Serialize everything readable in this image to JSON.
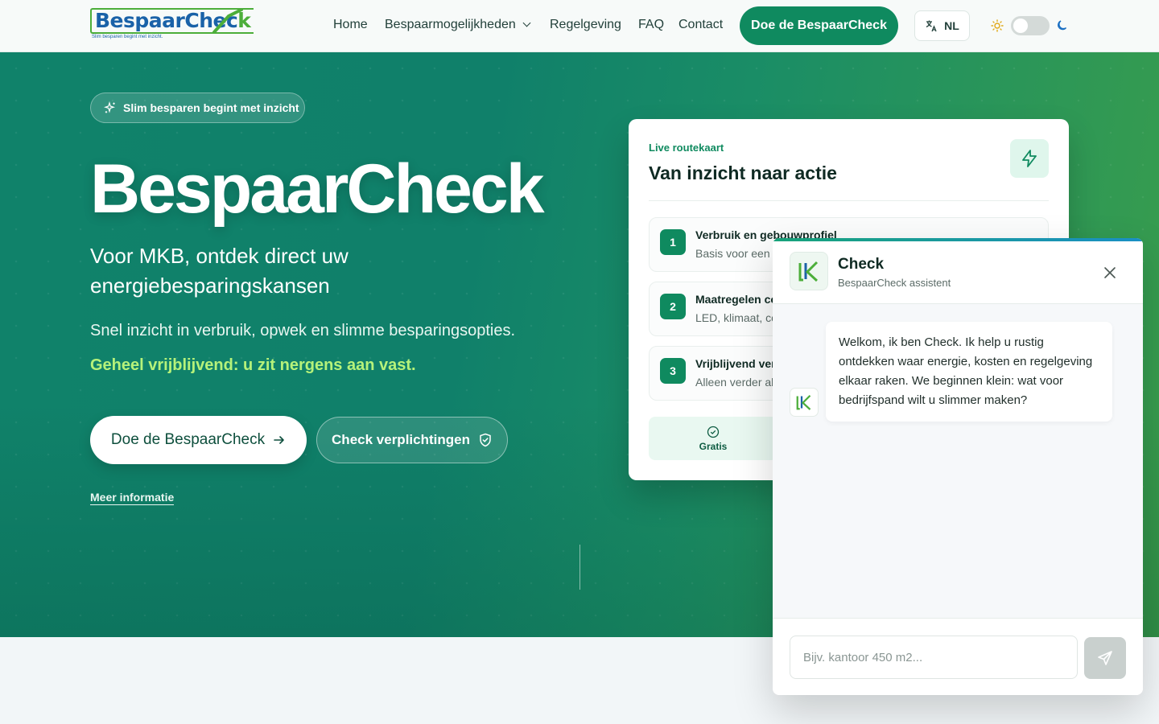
{
  "nav": {
    "logo_main": "BespaarChec",
    "logo_k": "k",
    "logo_tagline": "Slim besparen begint met inzicht.",
    "links": [
      "Home",
      "Bespaarmogelijkheden",
      "Regelgeving",
      "FAQ",
      "Contact"
    ],
    "cta": "Doe de BespaarCheck",
    "language": "NL"
  },
  "hero": {
    "badge": "Slim besparen begint met inzicht",
    "title": "BespaarCheck",
    "subtitle": "Voor MKB, ontdek direct uw energiebesparingskansen",
    "description": "Snel inzicht in verbruik, opwek en slimme besparingsopties.",
    "accent": "Geheel vrijblijvend: u zit nergens aan vast.",
    "primary_button": "Doe de BespaarCheck",
    "secondary_button": "Check verplichtingen",
    "more_link": "Meer informatie"
  },
  "card": {
    "kicker": "Live routekaart",
    "title": "Van inzicht naar actie",
    "steps": [
      {
        "num": "1",
        "title": "Verbruik en gebouwprofiel",
        "text": "Basis voor een r"
      },
      {
        "num": "2",
        "title": "Maatregelen co",
        "text": "LED, klimaat, co"
      },
      {
        "num": "3",
        "title": "Vrijblijvend ver",
        "text": "Alleen verder al"
      }
    ],
    "feature": "Gratis"
  },
  "chat": {
    "name": "Check",
    "role": "BespaarCheck assistent",
    "welcome": "Welkom, ik ben Check. Ik help u rustig ontdekken waar energie, kosten en regelgeving elkaar raken. We beginnen klein: wat voor bedrijfspand wilt u slimmer maken?",
    "input_placeholder": "Bijv. kantoor 450 m2..."
  },
  "icons": {
    "sparkle": "sparkle-icon",
    "lightning": "lightning-icon",
    "arrow": "arrow-right-icon",
    "shield": "shield-check-icon",
    "translate": "translate-icon",
    "sun": "sun-icon",
    "moon": "moon-icon",
    "close": "close-icon",
    "send": "send-icon",
    "check": "check-circle-icon"
  },
  "colors": {
    "primary": "#0f8a5f",
    "accent_text": "#b6f27a",
    "logo_blue": "#1a62a8",
    "logo_green": "#4cae3a"
  }
}
